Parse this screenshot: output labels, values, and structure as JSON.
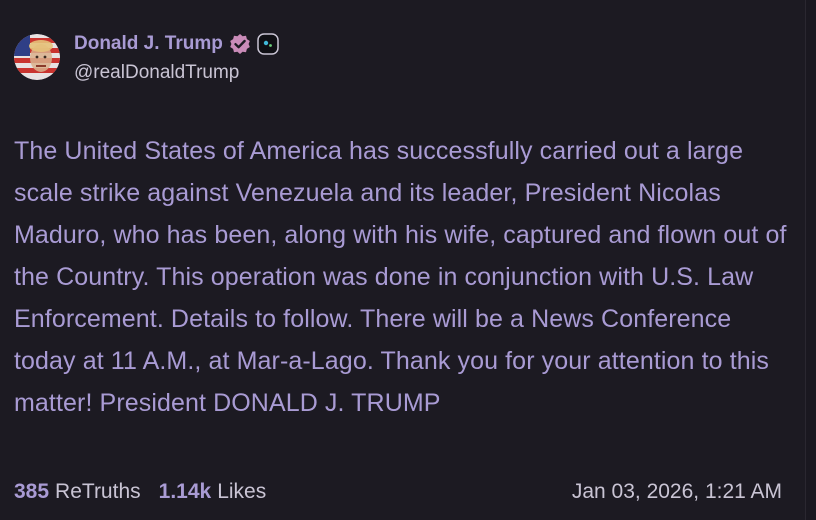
{
  "author": {
    "display_name": "Donald J. Trump",
    "handle": "@realDonaldTrump",
    "verified_icon": "verified-badge-icon",
    "secondary_icon": "ai-badge-icon",
    "avatar_icon": "avatar-flag-face"
  },
  "post": {
    "text": "The United States of America has successfully carried out a large scale strike against Venezuela and its leader, President Nicolas Maduro, who has been, along with his wife, captured and flown out of the Country. This operation was done in conjunction with U.S. Law Enforcement. Details to follow. There will be a News Conference today at 11 A.M., at Mar-a-Lago. Thank you for your attention to this matter! President DONALD J. TRUMP"
  },
  "stats": {
    "retruths_count": "385",
    "retruths_label": "ReTruths",
    "likes_count": "1.14k",
    "likes_label": "Likes"
  },
  "timestamp": "Jan 03, 2026, 1:21 AM",
  "colors": {
    "background": "#1c1a22",
    "accent": "#a99bd4",
    "muted_text": "#c9c4d4",
    "verified_badge": "#c98bb8"
  }
}
